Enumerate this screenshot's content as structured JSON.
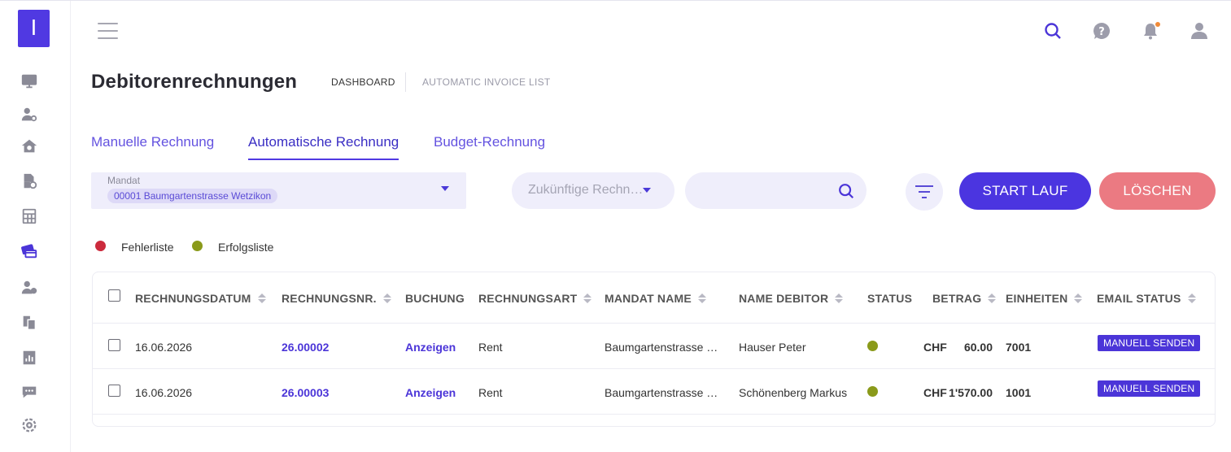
{
  "logo": {
    "glyph": "I"
  },
  "sidebar": {
    "icons": [
      "monitor-icon",
      "user-settings-icon",
      "house-settings-icon",
      "document-settings-icon",
      "calculator-icon",
      "invoice-cards-icon",
      "user-group-icon",
      "copy-documents-icon",
      "report-icon",
      "chat-icon",
      "gear-icon"
    ]
  },
  "header": {
    "title": "Debitorenrechnungen",
    "breadcrumb_1": "DASHBOARD",
    "breadcrumb_2": "AUTOMATIC INVOICE LIST"
  },
  "tabs": [
    {
      "label": "Manuelle Rechnung",
      "active": false
    },
    {
      "label": "Automatische Rechnung",
      "active": true
    },
    {
      "label": "Budget-Rechnung",
      "active": false
    }
  ],
  "filters": {
    "mandat_label": "Mandat",
    "mandat_value": "00001 Baumgartenstrasse Wetzikon",
    "future_select": "Zukünftige Rechn…",
    "search_placeholder": ""
  },
  "buttons": {
    "start": "START LAUF",
    "delete": "LÖSCHEN"
  },
  "legend": {
    "error": "Fehlerliste",
    "success": "Erfolgsliste",
    "error_color": "#cc2b3d",
    "success_color": "#8a9a1a"
  },
  "table": {
    "headers": [
      "RECHNUNGSDATUM",
      "RECHNUNGSNR.",
      "BUCHUNG",
      "RECHNUNGSART",
      "MANDAT NAME",
      "NAME DEBITOR",
      "STATUS",
      "BETRAG",
      "EINHEITEN",
      "EMAIL STATUS"
    ],
    "rows": [
      {
        "date": "16.06.2026",
        "number": "26.00002",
        "booking": "Anzeigen",
        "type": "Rent",
        "mandat": "Baumgartenstrasse …",
        "debitor": "Hauser Peter",
        "status": "success",
        "currency": "CHF",
        "amount": "60.00",
        "units": "7001",
        "email_status": "MANUELL SENDEN"
      },
      {
        "date": "16.06.2026",
        "number": "26.00003",
        "booking": "Anzeigen",
        "type": "Rent",
        "mandat": "Baumgartenstrasse …",
        "debitor": "Schönenberg Markus",
        "status": "success",
        "currency": "CHF",
        "amount": "1'570.00",
        "units": "1001",
        "email_status": "MANUELL SENDEN"
      }
    ]
  },
  "colors": {
    "primary": "#4b35e0",
    "danger": "#eb7a82",
    "accent_bg": "#efeefb"
  }
}
